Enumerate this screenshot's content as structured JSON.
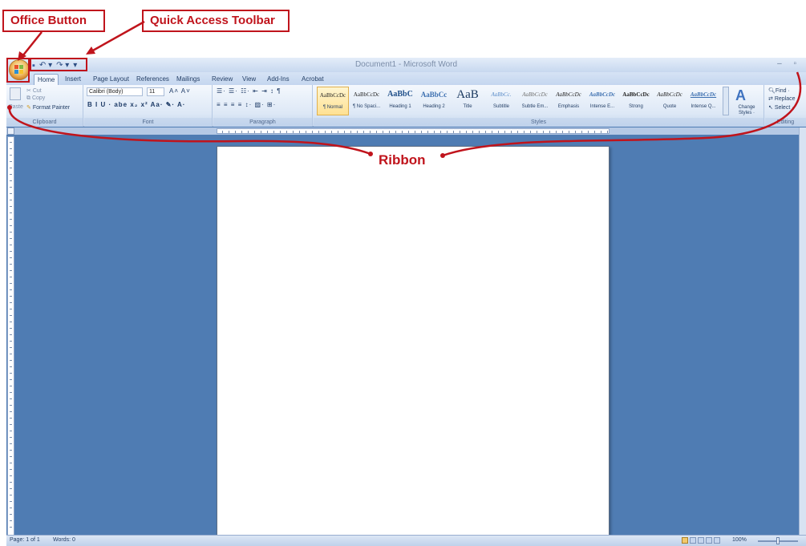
{
  "annotations": {
    "office_button": "Office Button",
    "quick_access_toolbar": "Quick Access Toolbar",
    "ribbon": "Ribbon",
    "color": "#c0141c"
  },
  "window": {
    "title": "Document1 - Microsoft Word",
    "controls": "–  ▫"
  },
  "qat": {
    "save_icon": "save-icon",
    "save": "▪",
    "undo": "↶ ▾",
    "redo": "↷ ▾",
    "customize": "▾"
  },
  "tabs": [
    "Home",
    "Insert",
    "Page Layout",
    "References",
    "Mailings",
    "Review",
    "View",
    "Add-Ins",
    "Acrobat"
  ],
  "clipboard": {
    "paste": "Paste",
    "cut": "Cut",
    "copy": "Copy",
    "format_painter": "Format Painter",
    "label": "Clipboard"
  },
  "font": {
    "name": "Calibri (Body)",
    "size": "11",
    "grow_shrink": "A˄  A˅",
    "row2": "B  I  U ·  abe  x₂  x²  Aa·  ✎·  A·",
    "label": "Font"
  },
  "paragraph": {
    "row1": "☰·  ☰·  ☷·  ⇤  ⇥  ↕  ¶",
    "row2": "≡  ≡  ≡  ≡  ↕·  ▨·  ⊞·",
    "label": "Paragraph"
  },
  "styles": {
    "label": "Styles",
    "items": [
      {
        "preview": "AaBbCcDc",
        "name": "¶ Normal"
      },
      {
        "preview": "AaBbCcDc",
        "name": "¶ No Spaci..."
      },
      {
        "preview": "AaBbC",
        "name": "Heading 1"
      },
      {
        "preview": "AaBbCc",
        "name": "Heading 2"
      },
      {
        "preview": "AaB",
        "name": "Title"
      },
      {
        "preview": "AaBbCc.",
        "name": "Subtitle"
      },
      {
        "preview": "AaBbCcDc",
        "name": "Subtle Em..."
      },
      {
        "preview": "AaBbCcDc",
        "name": "Emphasis"
      },
      {
        "preview": "AaBbCcDc",
        "name": "Intense E..."
      },
      {
        "preview": "AaBbCcDc",
        "name": "Strong"
      },
      {
        "preview": "AaBbCcDc",
        "name": "Quote"
      },
      {
        "preview": "AaBbCcDc",
        "name": "Intense Q..."
      }
    ],
    "change_styles": "Change Styles ·"
  },
  "editing": {
    "find": "Find ·",
    "replace": "Replace",
    "select": "Select ·",
    "label": "Editing"
  },
  "status": {
    "page": "Page: 1 of 1",
    "words": "Words: 0",
    "zoom": "100%"
  }
}
